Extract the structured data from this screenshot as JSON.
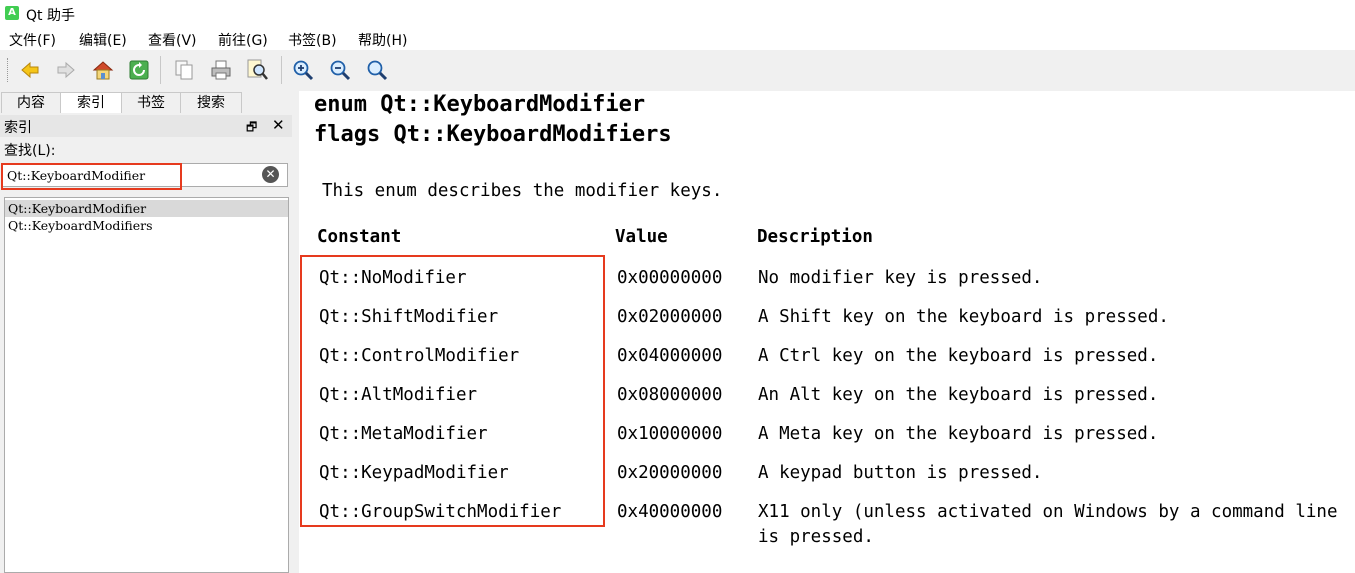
{
  "window": {
    "title": "Qt 助手",
    "app_icon_letter": "A"
  },
  "menu": [
    "文件(F)",
    "编辑(E)",
    "查看(V)",
    "前往(G)",
    "书签(B)",
    "帮助(H)"
  ],
  "toolbar": {
    "icons": [
      "back-arrow-icon",
      "forward-arrow-icon",
      "home-icon",
      "sync-icon",
      "copy-icon",
      "print-icon",
      "find-icon",
      "zoom-in-icon",
      "zoom-out-icon",
      "zoom-reset-icon"
    ]
  },
  "left_panel": {
    "tabs": [
      "内容",
      "索引",
      "书签",
      "搜索"
    ],
    "active_tab": "索引",
    "dock_title": "索引",
    "find_label": "查找(L):",
    "search_value": "Qt::KeyboardModifier",
    "results": [
      "Qt::KeyboardModifier",
      "Qt::KeyboardModifiers"
    ]
  },
  "doc": {
    "heading1": "enum Qt::KeyboardModifier",
    "heading2": "flags Qt::KeyboardModifiers",
    "intro": "This enum describes the modifier keys.",
    "columns": [
      "Constant",
      "Value",
      "Description"
    ],
    "rows": [
      {
        "constant": "Qt::NoModifier",
        "value": "0x00000000",
        "description": "No modifier key is pressed."
      },
      {
        "constant": "Qt::ShiftModifier",
        "value": "0x02000000",
        "description": "A Shift key on the keyboard is pressed."
      },
      {
        "constant": "Qt::ControlModifier",
        "value": "0x04000000",
        "description": "A Ctrl key on the keyboard is pressed."
      },
      {
        "constant": "Qt::AltModifier",
        "value": "0x08000000",
        "description": "An Alt key on the keyboard is pressed."
      },
      {
        "constant": "Qt::MetaModifier",
        "value": "0x10000000",
        "description": "A Meta key on the keyboard is pressed."
      },
      {
        "constant": "Qt::KeypadModifier",
        "value": "0x20000000",
        "description": "A keypad button is pressed."
      },
      {
        "constant": "Qt::GroupSwitchModifier",
        "value": "0x40000000",
        "description": "X11 only (unless activated on Windows by a command line",
        "description_cont": "is pressed."
      }
    ]
  },
  "colors": {
    "highlight_border": "#e63a1e",
    "toolbar_bg": "#f0f0f0",
    "selected_row": "#d9d9d9",
    "app_icon": "#41cd52"
  }
}
